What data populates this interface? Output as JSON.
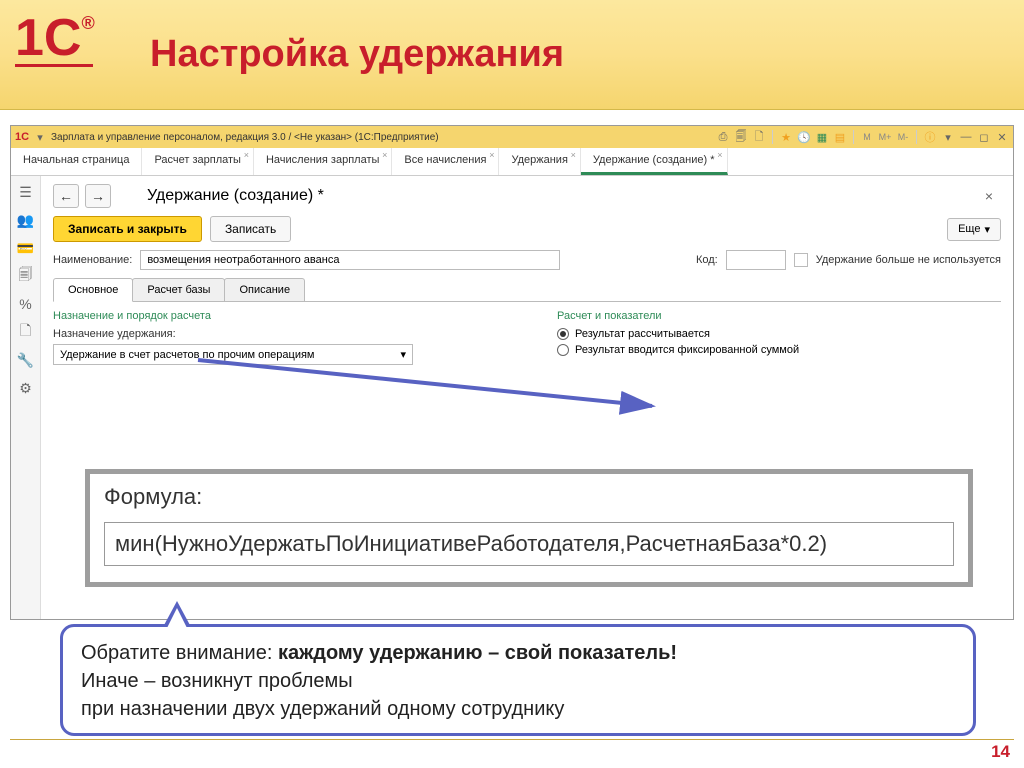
{
  "slide": {
    "title": "Настройка удержания",
    "page_num": "14"
  },
  "logo": {
    "text": "1C"
  },
  "app": {
    "title": "Зарплата и управление персоналом, редакция 3.0 / <Не указан>  (1С:Предприятие)"
  },
  "doc_tabs": [
    "Начальная страница",
    "Расчет зарплаты",
    "Начисления зарплаты",
    "Все начисления",
    "Удержания",
    "Удержание (создание) *"
  ],
  "page": {
    "title": "Удержание (создание) *",
    "btn_save_close": "Записать и закрыть",
    "btn_save": "Записать",
    "btn_more": "Еще",
    "label_name": "Наименование:",
    "value_name": "возмещения неотработанного аванса",
    "label_code": "Код:",
    "value_code": "",
    "checkbox_disabled": "Удержание больше не используется"
  },
  "sub_tabs": {
    "main": "Основное",
    "base": "Расчет базы",
    "desc": "Описание"
  },
  "form": {
    "section_purpose": "Назначение и порядок расчета",
    "label_purpose": "Назначение удержания:",
    "value_purpose": "Удержание в счет расчетов по прочим операциям",
    "section_calc": "Расчет и показатели",
    "radio_calculated": "Результат рассчитывается",
    "radio_fixed": "Результат вводится фиксированной суммой"
  },
  "formula": {
    "label": "Формула:",
    "text": "мин(НужноУдержатьПоИнициативеРаботодателя,РасчетнаяБаза*0.2)"
  },
  "note": {
    "line1a": "Обратите внимание: ",
    "line1b": "каждому удержанию – свой показатель!",
    "line2": "Иначе – возникнут проблемы",
    "line3": "при назначении двух удержаний одному сотруднику"
  }
}
